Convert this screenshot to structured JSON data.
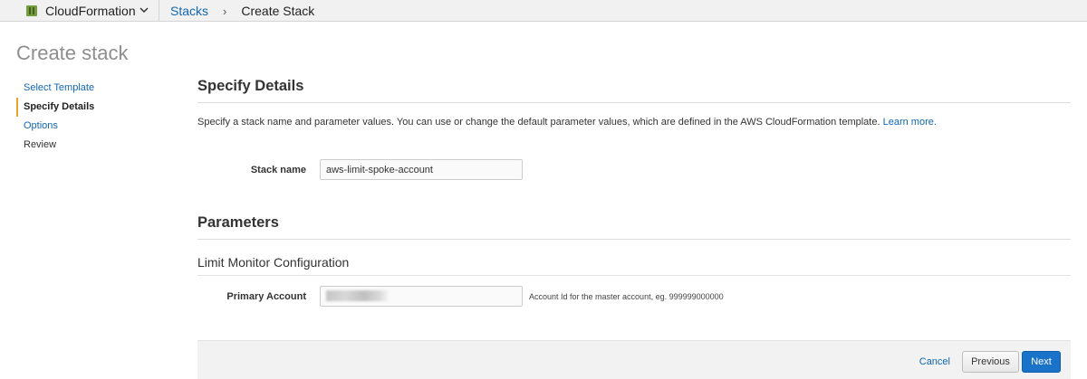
{
  "topbar": {
    "service_name": "CloudFormation",
    "breadcrumb_link": "Stacks",
    "breadcrumb_separator": "›",
    "breadcrumb_current": "Create Stack"
  },
  "page": {
    "title": "Create stack"
  },
  "sidebar": {
    "items": [
      {
        "label": "Select Template",
        "state": "link"
      },
      {
        "label": "Specify Details",
        "state": "active"
      },
      {
        "label": "Options",
        "state": "link"
      },
      {
        "label": "Review",
        "state": "plain"
      }
    ]
  },
  "details": {
    "heading": "Specify Details",
    "description": "Specify a stack name and parameter values. You can use or change the default parameter values, which are defined in the AWS CloudFormation template. ",
    "learn_more": "Learn more.",
    "stack_name_label": "Stack name",
    "stack_name_value": "aws-limit-spoke-account"
  },
  "parameters": {
    "heading": "Parameters",
    "group_heading": "Limit Monitor Configuration",
    "primary_account_label": "Primary Account",
    "primary_account_help": "Account Id for the master account, eg. 999999000000"
  },
  "footer": {
    "cancel_label": "Cancel",
    "previous_label": "Previous",
    "next_label": "Next"
  },
  "colors": {
    "link": "#1266b3",
    "active_marker": "#f0a023",
    "primary_button": "#1a73c8",
    "title_gray": "#8e8e8e"
  },
  "icons": {
    "service": "cloudformation-icon",
    "service_dropdown": "chevron-down-icon"
  }
}
